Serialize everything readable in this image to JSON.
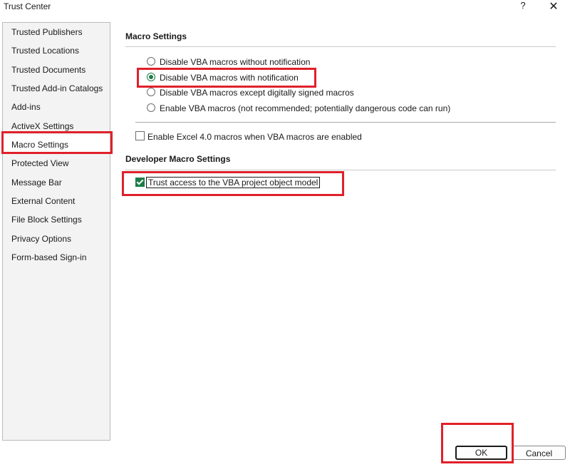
{
  "window": {
    "title": "Trust Center",
    "help_glyph": "?",
    "close_glyph": "✕"
  },
  "sidebar": {
    "items": [
      {
        "label": "Trusted Publishers"
      },
      {
        "label": "Trusted Locations"
      },
      {
        "label": "Trusted Documents"
      },
      {
        "label": "Trusted Add-in Catalogs"
      },
      {
        "label": "Add-ins"
      },
      {
        "label": "ActiveX Settings"
      },
      {
        "label": "Macro Settings",
        "selected": true
      },
      {
        "label": "Protected View"
      },
      {
        "label": "Message Bar"
      },
      {
        "label": "External Content"
      },
      {
        "label": "File Block Settings"
      },
      {
        "label": "Privacy Options"
      },
      {
        "label": "Form-based Sign-in"
      }
    ]
  },
  "macro_settings": {
    "heading": "Macro Settings",
    "options": [
      {
        "label": "Disable VBA macros without notification",
        "checked": false
      },
      {
        "label": "Disable VBA macros with notification",
        "checked": true
      },
      {
        "label": "Disable VBA macros except digitally signed macros",
        "checked": false
      },
      {
        "label": "Enable VBA macros (not recommended; potentially dangerous code can run)",
        "checked": false
      }
    ],
    "excel4_label": "Enable Excel 4.0 macros when VBA macros are enabled",
    "excel4_checked": false
  },
  "developer_settings": {
    "heading": "Developer Macro Settings",
    "trust_vba_label": "Trust access to the VBA project object model",
    "trust_vba_checked": true
  },
  "buttons": {
    "ok": "OK",
    "cancel": "Cancel"
  },
  "colors": {
    "highlight": "#e0202a",
    "accent": "#1c7d46"
  }
}
